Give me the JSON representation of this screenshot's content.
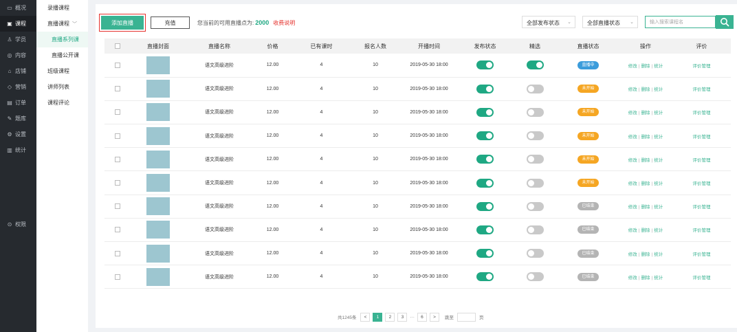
{
  "sidebar": {
    "top_items": [
      {
        "icon": "▭",
        "label": "概况",
        "active": false
      },
      {
        "icon": "▣",
        "label": "课程",
        "active": true
      },
      {
        "icon": "♙",
        "label": "学员",
        "active": false
      },
      {
        "icon": "◎",
        "label": "内容",
        "active": false
      },
      {
        "icon": "⌂",
        "label": "店铺",
        "active": false
      },
      {
        "icon": "◇",
        "label": "营销",
        "active": false
      },
      {
        "icon": "▤",
        "label": "订单",
        "active": false
      },
      {
        "icon": "✎",
        "label": "题库",
        "active": false
      },
      {
        "icon": "⚙",
        "label": "设置",
        "active": false
      },
      {
        "icon": "▥",
        "label": "统计",
        "active": false
      }
    ],
    "bottom_item": {
      "icon": "⊙",
      "label": "权限"
    }
  },
  "subnav": {
    "recorded": "录播课程",
    "live": "直播课程",
    "live_series": "直播系列课",
    "live_public": "直播公开课",
    "class": "班级课程",
    "lecturers": "讲师列表",
    "reviews": "课程评论"
  },
  "toolbar": {
    "add_label": "添加直播",
    "recharge_label": "充值",
    "points_text": "您当前的可用直播点为:",
    "points_value": "2000",
    "charge_link": "收费说明",
    "publish_filter": "全部发布状态",
    "live_filter": "全部直播状态",
    "search_placeholder": "输入搜索课程名"
  },
  "table": {
    "headers": [
      "",
      "直播封面",
      "直播名称",
      "价格",
      "已有课时",
      "报名人数",
      "开播时间",
      "发布状态",
      "精选",
      "直播状态",
      "操作",
      "评价"
    ],
    "actions": {
      "edit": "修改",
      "delete": "删除",
      "stats": "统计",
      "review": "评价管理"
    },
    "rows": [
      {
        "name": "语文高级进阶",
        "price": "12.00",
        "lessons": "4",
        "enrolled": "10",
        "time": "2019-05-30 18:00",
        "published": true,
        "featured": true,
        "status": "直播中",
        "status_color": "#3b9cdb"
      },
      {
        "name": "语文高级进阶",
        "price": "12.00",
        "lessons": "4",
        "enrolled": "10",
        "time": "2019-05-30 18:00",
        "published": true,
        "featured": false,
        "status": "未开始",
        "status_color": "#f5a623"
      },
      {
        "name": "语文高级进阶",
        "price": "12.00",
        "lessons": "4",
        "enrolled": "10",
        "time": "2019-05-30 18:00",
        "published": true,
        "featured": false,
        "status": "未开始",
        "status_color": "#f5a623"
      },
      {
        "name": "语文高级进阶",
        "price": "12.00",
        "lessons": "4",
        "enrolled": "10",
        "time": "2019-05-30 18:00",
        "published": true,
        "featured": false,
        "status": "未开始",
        "status_color": "#f5a623"
      },
      {
        "name": "语文高级进阶",
        "price": "12.00",
        "lessons": "4",
        "enrolled": "10",
        "time": "2019-05-30 18:00",
        "published": true,
        "featured": false,
        "status": "未开始",
        "status_color": "#f5a623"
      },
      {
        "name": "语文高级进阶",
        "price": "12.00",
        "lessons": "4",
        "enrolled": "10",
        "time": "2019-05-30 18:00",
        "published": true,
        "featured": false,
        "status": "未开始",
        "status_color": "#f5a623"
      },
      {
        "name": "语文高级进阶",
        "price": "12.00",
        "lessons": "4",
        "enrolled": "10",
        "time": "2019-05-30 18:00",
        "published": true,
        "featured": false,
        "status": "已结束",
        "status_color": "#b4b4b4"
      },
      {
        "name": "语文高级进阶",
        "price": "12.00",
        "lessons": "4",
        "enrolled": "10",
        "time": "2019-05-30 18:00",
        "published": true,
        "featured": false,
        "status": "已结束",
        "status_color": "#b4b4b4"
      },
      {
        "name": "语文高级进阶",
        "price": "12.00",
        "lessons": "4",
        "enrolled": "10",
        "time": "2019-05-30 18:00",
        "published": true,
        "featured": false,
        "status": "已结束",
        "status_color": "#b4b4b4"
      },
      {
        "name": "语文高级进阶",
        "price": "12.00",
        "lessons": "4",
        "enrolled": "10",
        "time": "2019-05-30 18:00",
        "published": true,
        "featured": false,
        "status": "已结束",
        "status_color": "#b4b4b4"
      }
    ]
  },
  "pagination": {
    "total": "共1245条",
    "prev": "<",
    "pages": [
      "1",
      "2",
      "3"
    ],
    "current": "1",
    "ellipsis": "···",
    "last": "6",
    "next": ">",
    "goto_label": "跳至",
    "page_label": "页"
  },
  "colors": {
    "accent": "#3ab392",
    "danger": "#e5322d"
  }
}
